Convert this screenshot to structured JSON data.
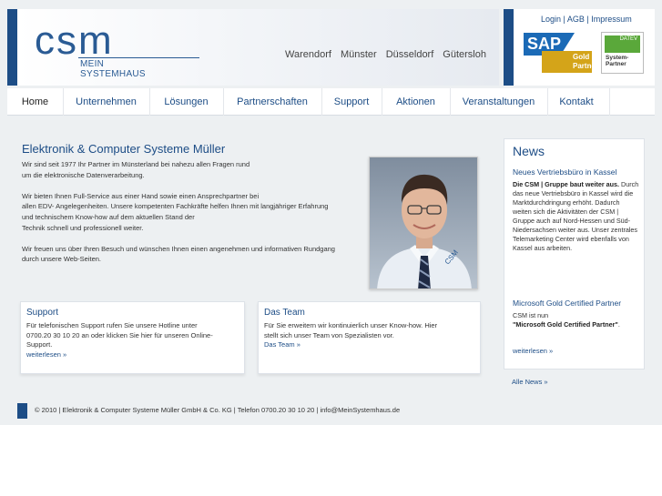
{
  "header": {
    "logo_text": "CSM",
    "logo_sub": "MEIN SYSTEMHAUS",
    "cities": [
      "Warendorf",
      "Münster",
      "Düsseldorf",
      "Gütersloh"
    ],
    "top_links": [
      "Login",
      "AGB",
      "Impressum"
    ],
    "sap_badge": {
      "brand": "SAP",
      "line1": "Gold",
      "line2": "Partner"
    },
    "datev_badge": {
      "brand": "DATEV",
      "line1": "System-",
      "line2": "Partner"
    }
  },
  "nav": {
    "items": [
      "Home",
      "Unternehmen",
      "Lösungen",
      "Partnerschaften",
      "Support",
      "Aktionen",
      "Veranstaltungen",
      "Kontakt"
    ],
    "active": "Home"
  },
  "main": {
    "title": "Elektronik & Computer Systeme Müller",
    "paragraphs": [
      "Wir sind seit 1977 Ihr Partner im Münsterland bei nahezu allen Fragen rund\num die elektronische Datenverarbeitung.",
      "Wir bieten Ihnen Full-Service aus einer Hand sowie einen Ansprechpartner bei\nallen EDV- Angelegenheiten. Unsere kompetenten Fachkräfte helfen Ihnen mit langjähriger Erfahrung\nund technischem Know-how auf dem aktuellen Stand der\nTechnik schnell und professionell weiter.",
      "Wir freuen uns über Ihren Besuch und wünschen Ihnen einen angenehmen und informativen Rundgang\ndurch unsere Web-Seiten."
    ]
  },
  "boxes": {
    "support": {
      "title": "Support",
      "text": "Für telefonischen Support rufen Sie unsere Hotline unter\n0700.20 30 10 20 an oder klicken Sie hier für unseren Online-\nSupport.",
      "link": "weiterlesen »"
    },
    "team": {
      "title": "Das Team",
      "text": "Für Sie erweitern wir kontinuierlich unser Know-how. Hier\nstellt sich unser Team von Spezialisten vor.",
      "link": "Das Team »"
    }
  },
  "news": {
    "heading": "News",
    "items": [
      {
        "title": "Neues Vertriebsbüro in Kassel",
        "lead": "Die CSM | Gruppe baut weiter aus.",
        "body": " Durch das neue Vertriebsbüro in Kassel wird die Marktdurchdringung erhöht. Dadurch weiten sich die Aktivitäten der CSM | Gruppe auch auf Nord-Hessen und Süd-Niedersachsen weiter aus. Unser zentrales Telemarketing Center wird ebenfalls von Kassel aus arbeiten."
      },
      {
        "title": "Microsoft Gold Certified Partner",
        "pre": "CSM ist nun",
        "lead": "\"Microsoft Gold Certified Partner\"",
        "post": ".",
        "more": "weiterlesen »"
      }
    ],
    "all_news": "Alle News »"
  },
  "footer": {
    "text": "© 2010 | Elektronik & Computer Systeme Müller GmbH & Co. KG | Telefon 0700.20 30 10 20 | info@MeinSystemhaus.de"
  },
  "colors": {
    "brand_blue": "#1d4d86",
    "page_bg": "#edf0f2",
    "sap_blue": "#1b6ab6",
    "sap_gold": "#d4a419",
    "datev_green": "#5aa83a"
  }
}
